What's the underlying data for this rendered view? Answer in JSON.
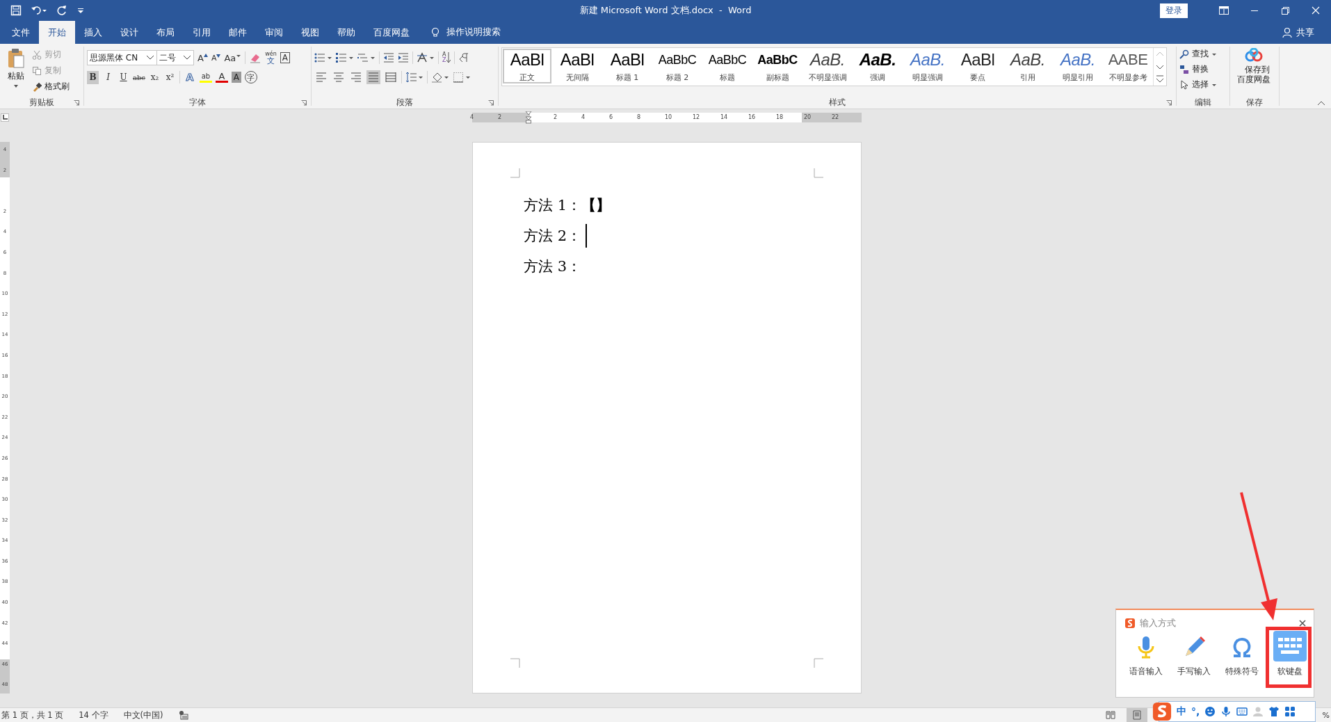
{
  "window": {
    "title": "新建 Microsoft Word 文档.docx  -  Word",
    "login": "登录"
  },
  "tabs": [
    {
      "label": "文件",
      "selected": false
    },
    {
      "label": "开始",
      "selected": true
    },
    {
      "label": "插入",
      "selected": false
    },
    {
      "label": "设计",
      "selected": false
    },
    {
      "label": "布局",
      "selected": false
    },
    {
      "label": "引用",
      "selected": false
    },
    {
      "label": "邮件",
      "selected": false
    },
    {
      "label": "审阅",
      "selected": false
    },
    {
      "label": "视图",
      "selected": false
    },
    {
      "label": "帮助",
      "selected": false
    },
    {
      "label": "百度网盘",
      "selected": false
    }
  ],
  "tell_me": "操作说明搜索",
  "share": "共享",
  "clipboard": {
    "paste": "粘贴",
    "cut": "剪切",
    "copy": "复制",
    "format_painter": "格式刷",
    "label": "剪贴板"
  },
  "font": {
    "name": "思源黑体 CN",
    "size": "二号",
    "label": "字体",
    "size_buttons": [
      {
        "label": "A",
        "kind": "grow"
      },
      {
        "label": "A",
        "kind": "shrink"
      },
      {
        "label": "Aa",
        "kind": "case"
      }
    ],
    "phonetic": {
      "ruby": "wén",
      "label": "文"
    },
    "border_char": "A",
    "format_buttons": [
      {
        "label": "B",
        "kind": "bold",
        "selected": true
      },
      {
        "label": "I",
        "kind": "italic",
        "selected": false
      },
      {
        "label": "U",
        "kind": "underline",
        "selected": false
      },
      {
        "label": "abc",
        "kind": "strike",
        "selected": false
      },
      {
        "label": "x₂",
        "kind": "sub",
        "selected": false
      },
      {
        "label": "x²",
        "kind": "sup",
        "selected": false
      }
    ],
    "effect_buttons": [
      {
        "label": "A",
        "kind": "effects"
      },
      {
        "label": "ab",
        "kind": "highlight"
      },
      {
        "label": "A",
        "kind": "color"
      },
      {
        "label": "A",
        "kind": "shade"
      },
      {
        "label": "字",
        "kind": "enclosed"
      }
    ]
  },
  "paragraph": {
    "label": "段落",
    "sort": {
      "top": "A",
      "bottom": "Z"
    },
    "align_buttons": [
      {
        "kind": "left",
        "selected": false
      },
      {
        "kind": "center",
        "selected": false
      },
      {
        "kind": "right",
        "selected": false
      },
      {
        "kind": "justify",
        "selected": true
      },
      {
        "kind": "distributed",
        "selected": false
      }
    ]
  },
  "styles": {
    "label": "样式",
    "items": [
      {
        "preview": "AaBl",
        "label": "正文",
        "kind": "plain",
        "selected": true
      },
      {
        "preview": "AaBl",
        "label": "无间隔",
        "kind": "plain",
        "selected": false
      },
      {
        "preview": "AaBl",
        "label": "标题 1",
        "kind": "heading",
        "selected": false
      },
      {
        "preview": "AaBbC",
        "label": "标题 2",
        "kind": "small",
        "selected": false
      },
      {
        "preview": "AaBbC",
        "label": "标题",
        "kind": "small",
        "selected": false
      },
      {
        "preview": "AaBbC",
        "label": "副标题",
        "kind": "bold",
        "selected": false
      },
      {
        "preview": "AaB.",
        "label": "不明显强调",
        "kind": "italic",
        "selected": false
      },
      {
        "preview": "AaB.",
        "label": "强调",
        "kind": "italic-bold",
        "selected": false
      },
      {
        "preview": "AaB.",
        "label": "明显强调",
        "kind": "accent",
        "selected": false
      },
      {
        "preview": "AaBl",
        "label": "要点",
        "kind": "light",
        "selected": false
      },
      {
        "preview": "AaB.",
        "label": "引用",
        "kind": "italic",
        "selected": false
      },
      {
        "preview": "AaB.",
        "label": "明显引用",
        "kind": "accent",
        "selected": false
      },
      {
        "preview": "AABE",
        "label": "不明显参考",
        "kind": "grey",
        "selected": false
      }
    ]
  },
  "editing": {
    "label": "编辑",
    "find": "查找",
    "replace": "替换",
    "select": "选择"
  },
  "save": {
    "label": "保存",
    "button": "保存到百度网盘"
  },
  "horizontal_ruler": [
    "4",
    "2",
    "2",
    "4",
    "6",
    "8",
    "10",
    "12",
    "14",
    "16",
    "18",
    "20",
    "22"
  ],
  "vertical_ruler": [
    "4",
    "2",
    "2",
    "4",
    "6",
    "8",
    "10",
    "12",
    "14",
    "16",
    "18",
    "20",
    "22",
    "24",
    "26",
    "28",
    "30",
    "32",
    "34",
    "36",
    "38",
    "40",
    "42",
    "44",
    "46",
    "48"
  ],
  "document": {
    "lines": [
      {
        "text": "方法 1：**【】**",
        "cursor": false
      },
      {
        "text": "方法 2：",
        "cursor": true
      },
      {
        "text": "方法 3：",
        "cursor": false
      }
    ]
  },
  "status_bar": {
    "page": "第 1 页，共 1 页",
    "words": "14 个字",
    "language": "中文(中国)",
    "views": [
      {
        "kind": "read",
        "selected": false
      },
      {
        "kind": "print",
        "selected": true
      }
    ],
    "zoom": "%"
  },
  "ime_panel": {
    "title": "输入方式",
    "options": [
      {
        "label": "语音输入",
        "kind": "voice",
        "highlighted": false
      },
      {
        "label": "手写输入",
        "kind": "handwrite",
        "highlighted": false
      },
      {
        "label": "特殊符号",
        "kind": "symbol",
        "highlighted": false
      },
      {
        "label": "软键盘",
        "kind": "keyboard",
        "highlighted": true
      }
    ]
  },
  "ime_bar": {
    "mode": "中",
    "punct": "°,"
  }
}
